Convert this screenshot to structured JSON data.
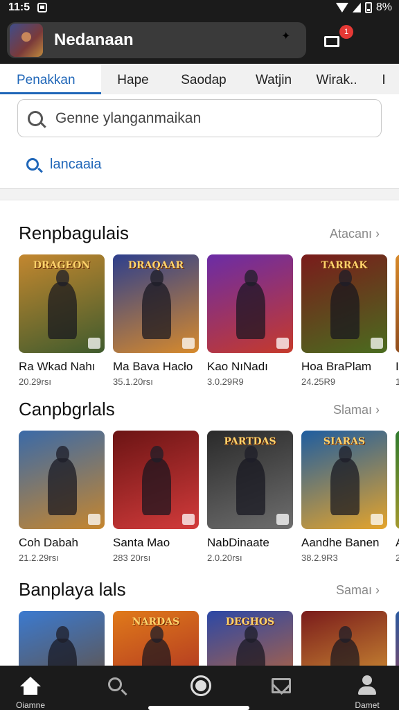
{
  "status": {
    "time": "11:5",
    "battery_text": "8%"
  },
  "app": {
    "title": "Nedanaan",
    "cart_badge": "1"
  },
  "tabs": [
    {
      "label": "Penakkan",
      "active": true
    },
    {
      "label": "Hape"
    },
    {
      "label": "Saodap"
    },
    {
      "label": "Watjin"
    },
    {
      "label": "Wirak.."
    },
    {
      "label": "I"
    }
  ],
  "search": {
    "placeholder": "Genne ylanganmaikan",
    "link_label": "lancaaia"
  },
  "sections": [
    {
      "title": "Renpbagulais",
      "more": "Atacanı",
      "items": [
        {
          "name": "Ra Wkad Nahı",
          "meta": "20.29rsı",
          "logo": "DRAGEON",
          "colors": [
            "#c3872f",
            "#3f5b2d"
          ]
        },
        {
          "name": "Ma Bava Hacło",
          "meta": "35.1.20rsı",
          "logo": "DRAQAAR",
          "colors": [
            "#2d3f8d",
            "#d78a2c"
          ]
        },
        {
          "name": "Kao NıNadı",
          "meta": "3.0.29R9",
          "logo": "",
          "colors": [
            "#6b2ca6",
            "#c63a2b"
          ]
        },
        {
          "name": "Hoa BraPlam",
          "meta": "24.25R9",
          "logo": "TARRAK",
          "colors": [
            "#7a1b1b",
            "#4a6c1f"
          ]
        },
        {
          "name": "I",
          "meta": "1",
          "logo": "",
          "colors": [
            "#d88a2a",
            "#7a3a1a"
          ]
        }
      ]
    },
    {
      "title": "Canpbgrlals",
      "more": "Slamaı",
      "items": [
        {
          "name": "Coh Dabah",
          "meta": "21.2.29rsı",
          "logo": "",
          "colors": [
            "#3a6aa8",
            "#c6862e"
          ]
        },
        {
          "name": "Santa Mao",
          "meta": "283 20rsı",
          "logo": "",
          "colors": [
            "#6b1414",
            "#d23b3b"
          ]
        },
        {
          "name": "NabDinaate",
          "meta": "2.0.20rsı",
          "logo": "PARTDAS",
          "colors": [
            "#2a2a2a",
            "#6e6e6e"
          ]
        },
        {
          "name": "Aandhe Banen",
          "meta": "38.2.9R3",
          "logo": "SIARAS",
          "colors": [
            "#1e5da0",
            "#e5a42b"
          ]
        },
        {
          "name": "A",
          "meta": "2",
          "logo": "",
          "colors": [
            "#2e7a2e",
            "#c8a22e"
          ]
        }
      ]
    },
    {
      "title": "Banplaya lals",
      "more": "Samaı",
      "items": [
        {
          "name": "",
          "meta": "",
          "logo": "",
          "colors": [
            "#3b7ad0",
            "#6a4a2a"
          ]
        },
        {
          "name": "",
          "meta": "",
          "logo": "NARDAS",
          "colors": [
            "#e07a1a",
            "#a32424"
          ]
        },
        {
          "name": "",
          "meta": "",
          "logo": "DEGHOS",
          "colors": [
            "#2c48a6",
            "#d06a2a"
          ]
        },
        {
          "name": "",
          "meta": "",
          "logo": "",
          "colors": [
            "#7a1b1b",
            "#e0a83a"
          ]
        },
        {
          "name": "",
          "meta": "",
          "logo": "",
          "colors": [
            "#2a5aa0",
            "#c23a3a"
          ]
        }
      ]
    }
  ],
  "nav": [
    {
      "label": "Oiamne",
      "icon": "home-icon"
    },
    {
      "label": "",
      "icon": "search-icon"
    },
    {
      "label": "",
      "icon": "record-icon"
    },
    {
      "label": "",
      "icon": "mail-icon"
    },
    {
      "label": "Damet",
      "icon": "user-icon"
    }
  ]
}
